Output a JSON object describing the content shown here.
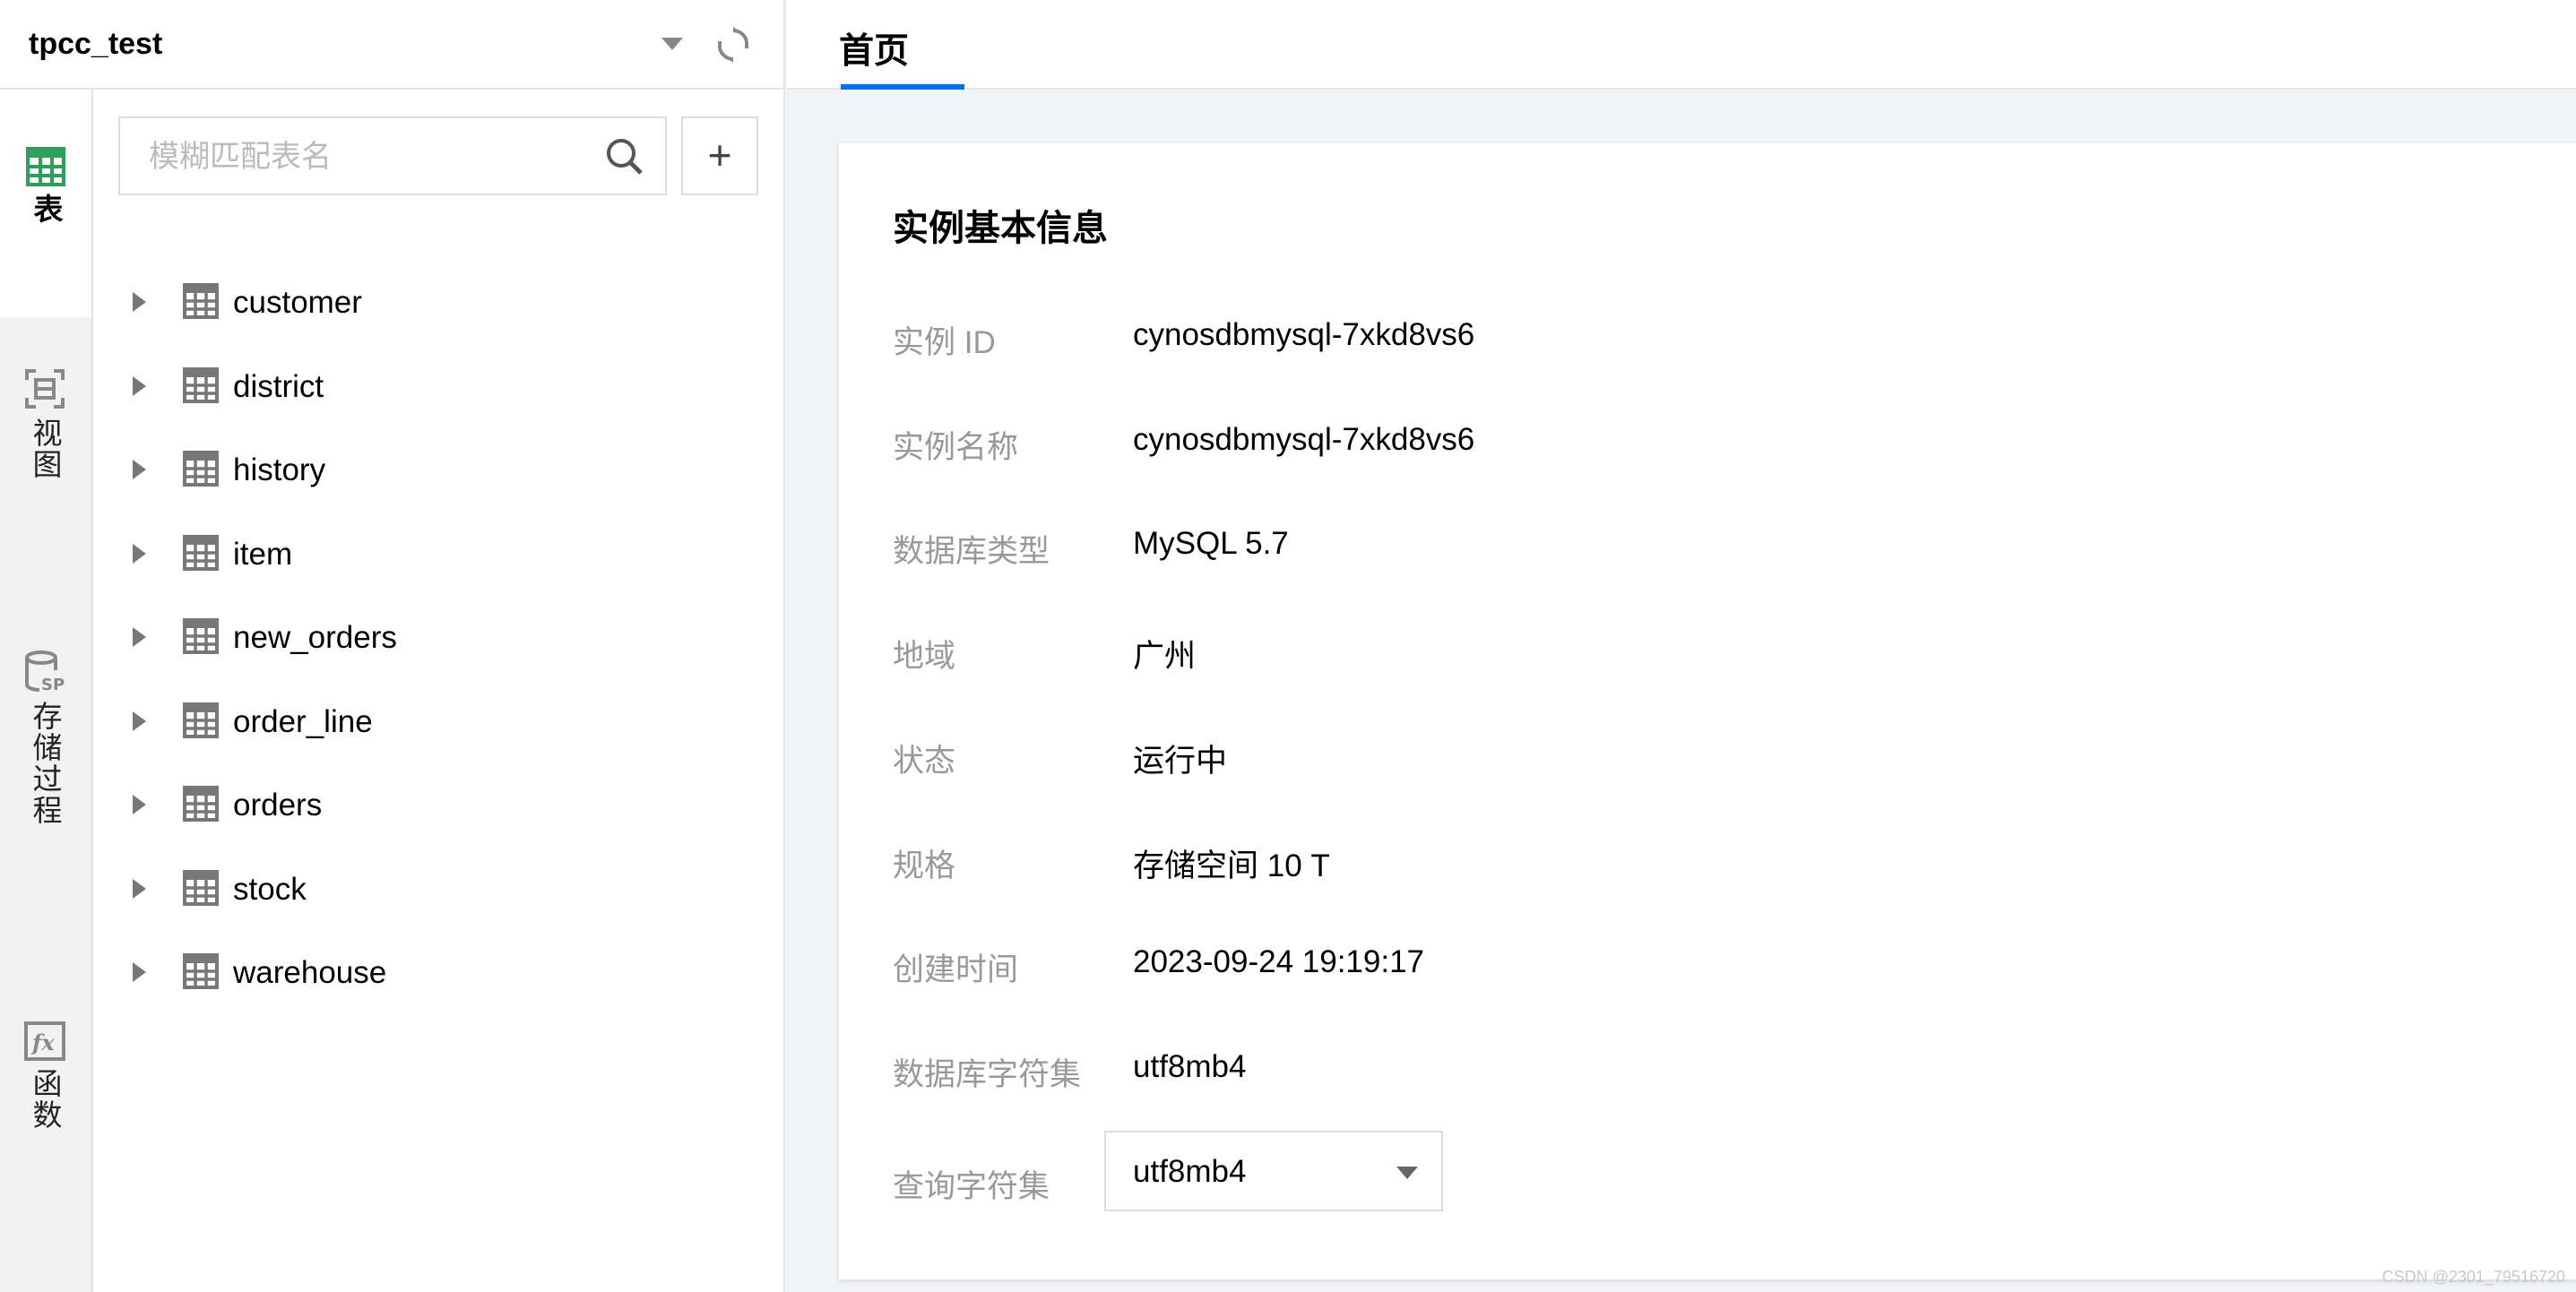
{
  "database": {
    "name": "tpcc_test"
  },
  "sidebar": {
    "items": [
      {
        "label": "表",
        "icon": "table-icon",
        "active": true
      },
      {
        "label": "视图",
        "icon": "view-icon",
        "active": false
      },
      {
        "label": "存储过程",
        "icon": "stored-procedure-icon",
        "active": false
      },
      {
        "label": "函数",
        "icon": "function-icon",
        "active": false
      }
    ]
  },
  "search": {
    "placeholder": "模糊匹配表名",
    "add_label": "+"
  },
  "tables": [
    "customer",
    "district",
    "history",
    "item",
    "new_orders",
    "order_line",
    "orders",
    "stock",
    "warehouse"
  ],
  "tabs": [
    {
      "label": "首页",
      "active": true
    }
  ],
  "card": {
    "title": "实例基本信息",
    "rows": [
      {
        "label": "实例 ID",
        "value": "cynosdbmysql-7xkd8vs6"
      },
      {
        "label": "实例名称",
        "value": "cynosdbmysql-7xkd8vs6"
      },
      {
        "label": "数据库类型",
        "value": "MySQL 5.7"
      },
      {
        "label": "地域",
        "value": "广州"
      },
      {
        "label": "状态",
        "value": "运行中"
      },
      {
        "label": "规格",
        "value": "存储空间 10 T"
      },
      {
        "label": "创建时间",
        "value": "2023-09-24 19:19:17"
      },
      {
        "label": "数据库字符集",
        "value": "utf8mb4"
      }
    ],
    "query_charset": {
      "label": "查询字符集",
      "value": "utf8mb4"
    }
  },
  "watermark": "CSDN @2301_79516720",
  "colors": {
    "accent": "#006eff",
    "table_icon_active": "#2e9e5b",
    "icon_gray": "#888888"
  }
}
